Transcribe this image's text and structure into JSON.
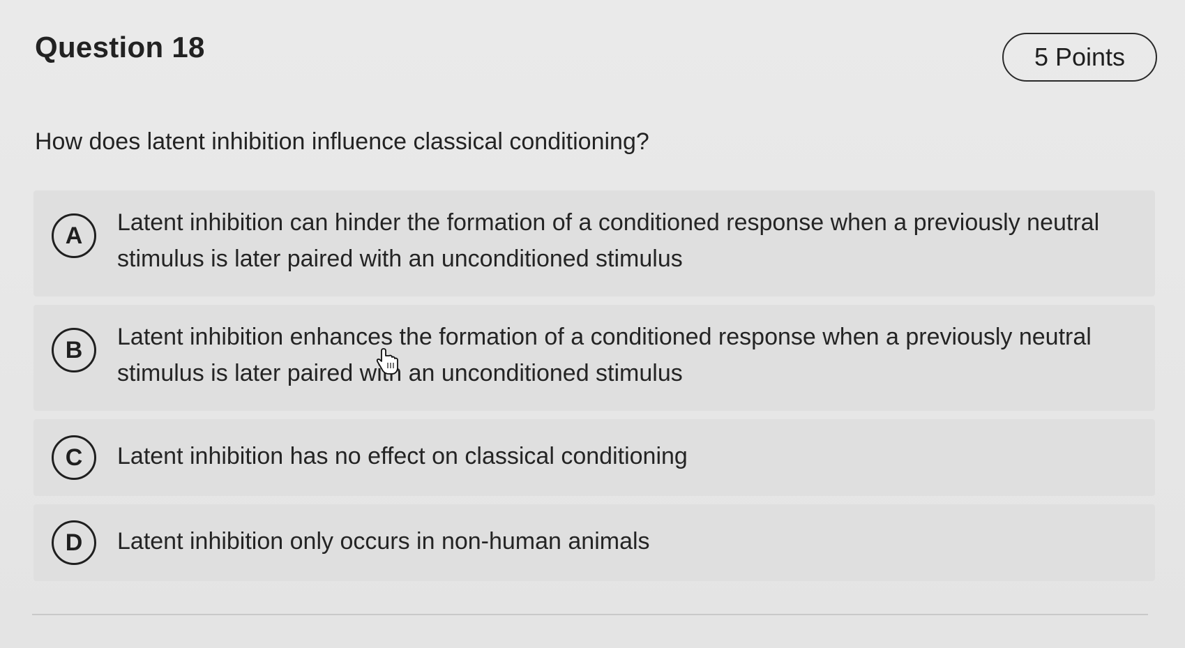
{
  "question": {
    "title": "Question 18",
    "points": "5 Points",
    "text": "How does latent inhibition influence classical conditioning?"
  },
  "options": [
    {
      "letter": "A",
      "text": "Latent inhibition can hinder the formation of a conditioned response when a previously neutral stimulus is later paired with an unconditioned stimulus"
    },
    {
      "letter": "B",
      "text": "Latent inhibition enhances the formation of a conditioned response when a previously neutral stimulus is later paired with an unconditioned stimulus"
    },
    {
      "letter": "C",
      "text": "Latent inhibition has no effect on classical conditioning"
    },
    {
      "letter": "D",
      "text": "Latent inhibition only occurs in non-human animals"
    }
  ],
  "icons": {
    "cursor": "hand-pointer-icon"
  }
}
